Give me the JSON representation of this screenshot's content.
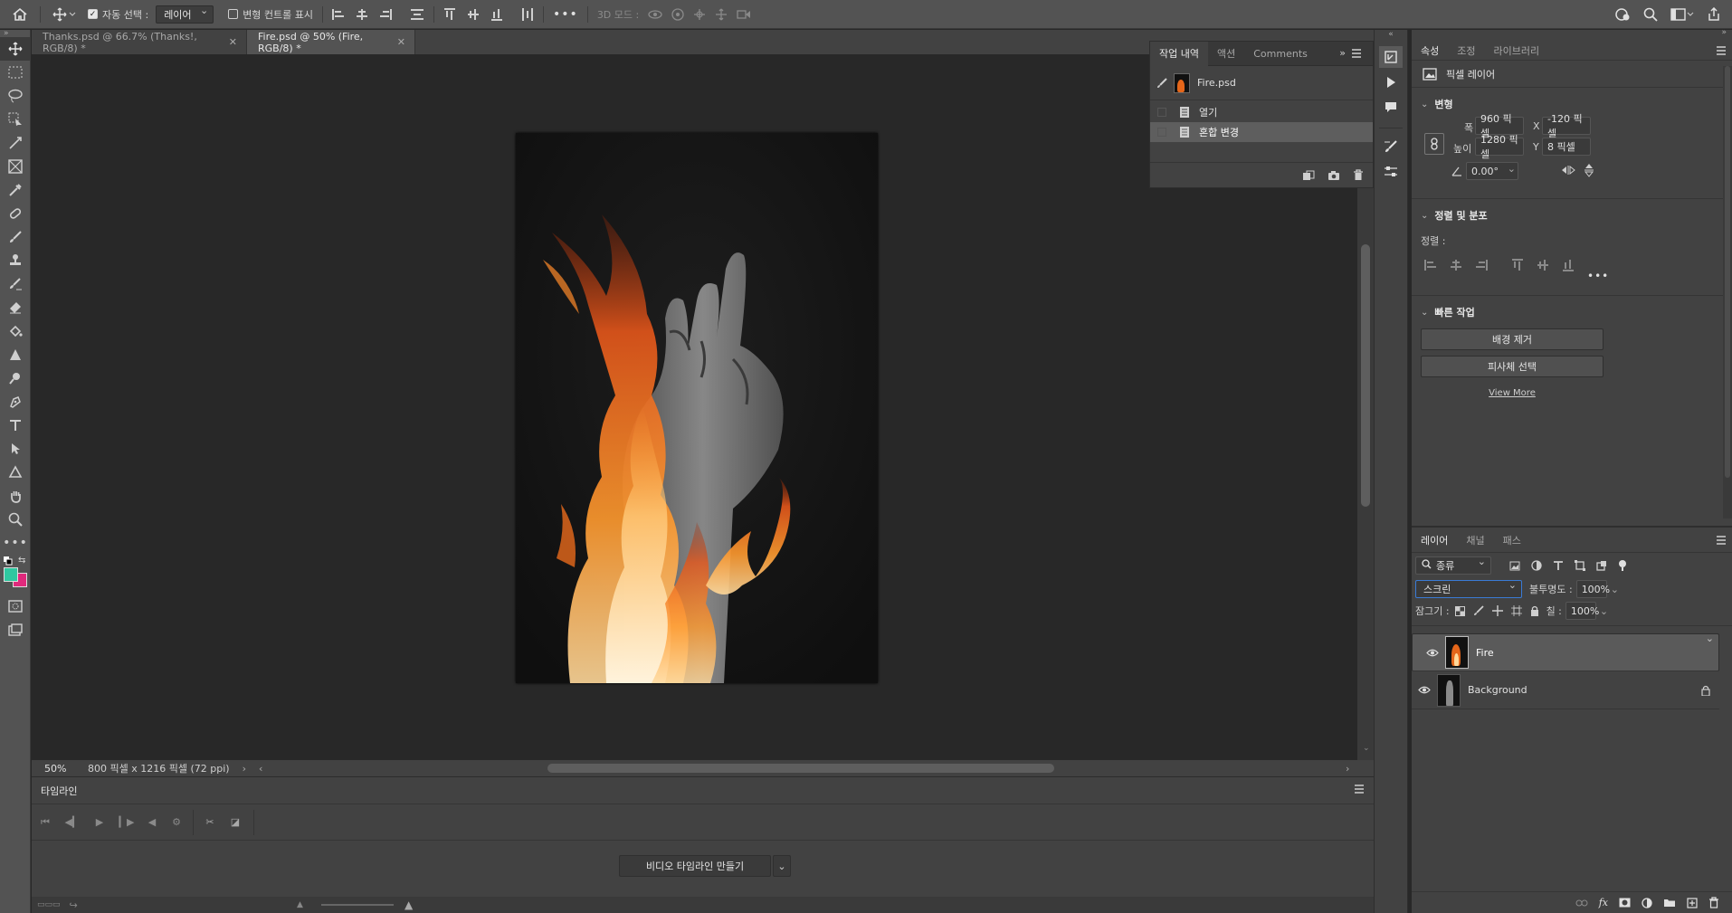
{
  "options_bar": {
    "auto_select_label": "자동 선택 :",
    "auto_select_checked": true,
    "auto_select_value": "레이어",
    "transform_controls_label": "변형 컨트롤 표시",
    "transform_controls_checked": false,
    "more_label": "•••",
    "mode_3d_label": "3D 모드 :"
  },
  "tabs": [
    {
      "label": "Thanks.psd @ 66.7% (Thanks!, RGB/8) *",
      "active": false
    },
    {
      "label": "Fire.psd @ 50% (Fire, RGB/8) *",
      "active": true
    }
  ],
  "status_bar": {
    "zoom": "50%",
    "doc_info": "800 픽셀 x 1216 픽셀 (72 ppi)"
  },
  "timeline": {
    "title": "타임라인",
    "create_button": "비디오 타임라인 만들기"
  },
  "history_panel": {
    "tabs": [
      "작업 내역",
      "액션",
      "Comments"
    ],
    "snapshot_label": "Fire.psd",
    "items": [
      "열기",
      "혼합 변경"
    ]
  },
  "properties": {
    "tabs": [
      "속성",
      "조정",
      "라이브러리"
    ],
    "layer_type": "픽셀 레이어",
    "transform": {
      "title": "변형",
      "w_label": "폭",
      "w_value": "960 픽셀",
      "h_label": "높이",
      "h_value": "1280 픽셀",
      "x_label": "X",
      "x_value": "-120 픽셀",
      "y_label": "Y",
      "y_value": "8 픽셀",
      "angle_value": "0.00°"
    },
    "align": {
      "title": "정렬 및 분포",
      "label": "정렬 :",
      "more": "•••"
    },
    "quick_actions": {
      "title": "빠른 작업",
      "remove_bg": "배경 제거",
      "select_subject": "피사체 선택",
      "view_more": "View More"
    }
  },
  "layers_panel": {
    "tabs": [
      "레이어",
      "채널",
      "패스"
    ],
    "filter_label": "종류",
    "blend_mode": "스크린",
    "opacity_label": "불투명도 :",
    "opacity_value": "100%",
    "lock_label": "잠그기 :",
    "fill_label": "칠 :",
    "fill_value": "100%",
    "layers": [
      {
        "name": "Fire",
        "selected": true,
        "locked": false
      },
      {
        "name": "Background",
        "selected": false,
        "locked": true
      }
    ]
  },
  "colors": {
    "foreground": "#2fc8a0",
    "background": "#e0297c"
  }
}
